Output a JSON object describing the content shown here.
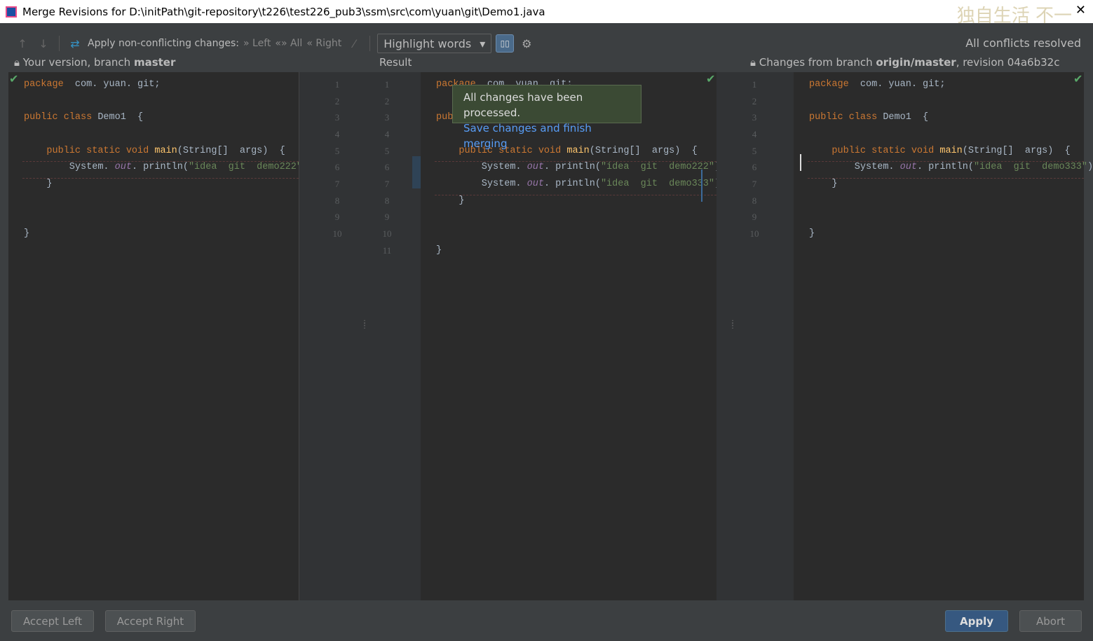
{
  "window": {
    "title": "Merge Revisions for D:\\initPath\\git-repository\\t226\\test226_pub3\\ssm\\src\\com\\yuan\\git\\Demo1.java",
    "watermark": "独自生活 不一"
  },
  "toolbar": {
    "apply_label": "Apply non-conflicting changes:",
    "left": "Left",
    "all": "All",
    "right": "Right",
    "highlight": "Highlight words",
    "status": "All conflicts resolved"
  },
  "headers": {
    "left_prefix": "Your version, branch ",
    "left_branch": "master",
    "center": "Result",
    "right_prefix": "Changes from branch ",
    "right_branch": "origin/master",
    "right_suffix": ", revision 04a6b32c"
  },
  "tooltip": {
    "message": "All changes have been processed.",
    "link": "Save changes and finish merging"
  },
  "left_lines": [
    [
      [
        "kw",
        "package"
      ],
      [
        "",
        "  com. yuan. git;"
      ]
    ],
    [],
    [
      [
        "kw",
        "public class"
      ],
      [
        "",
        " Demo1  {"
      ]
    ],
    [],
    [
      [
        "",
        "    "
      ],
      [
        "kw",
        "public static void "
      ],
      [
        "fn",
        "main"
      ],
      [
        "",
        "(String[]  args)  {"
      ]
    ],
    [
      [
        "",
        "        System. "
      ],
      [
        "it",
        "out"
      ],
      [
        "",
        ". println("
      ],
      [
        "st",
        "\"idea  git  demo222\""
      ],
      [
        "",
        ");"
      ]
    ],
    [
      [
        "",
        "    }"
      ]
    ],
    [],
    [],
    [
      [
        "",
        "}"
      ]
    ]
  ],
  "center_lines": [
    [
      [
        "kw",
        "package"
      ],
      [
        "",
        "  com. yuan. git;"
      ]
    ],
    [],
    [
      [
        "kw",
        "publ"
      ]
    ],
    [],
    [
      [
        "",
        "    "
      ],
      [
        "kw",
        "public static void "
      ],
      [
        "fn",
        "main"
      ],
      [
        "",
        "(String[]  args)  {"
      ]
    ],
    [
      [
        "",
        "        System. "
      ],
      [
        "it",
        "out"
      ],
      [
        "",
        ". println("
      ],
      [
        "st",
        "\"idea  git  demo222\""
      ],
      [
        "",
        ");"
      ]
    ],
    [
      [
        "",
        "        System. "
      ],
      [
        "it",
        "out"
      ],
      [
        "",
        ". println("
      ],
      [
        "st",
        "\"idea  git  demo333\""
      ],
      [
        "",
        ");"
      ]
    ],
    [
      [
        "",
        "    }"
      ]
    ],
    [],
    [],
    [
      [
        "",
        "}"
      ]
    ]
  ],
  "right_lines": [
    [
      [
        "kw",
        "package"
      ],
      [
        "",
        "  com. yuan. git;"
      ]
    ],
    [],
    [
      [
        "kw",
        "public class"
      ],
      [
        "",
        " Demo1  {"
      ]
    ],
    [],
    [
      [
        "",
        "    "
      ],
      [
        "kw",
        "public static void "
      ],
      [
        "fn",
        "main"
      ],
      [
        "",
        "(String[]  args)  {"
      ]
    ],
    [
      [
        "",
        "        System. "
      ],
      [
        "it",
        "out"
      ],
      [
        "",
        ". println("
      ],
      [
        "st",
        "\"idea  git  demo333\""
      ],
      [
        "",
        ");"
      ]
    ],
    [
      [
        "",
        "    }"
      ]
    ],
    [],
    [],
    [
      [
        "",
        "}"
      ]
    ]
  ],
  "gutter_left": [
    "1",
    "2",
    "3",
    "4",
    "5",
    "6",
    "7",
    "8",
    "9",
    "10"
  ],
  "gutter_center": [
    "1",
    "2",
    "3",
    "4",
    "5",
    "6",
    "7",
    "8",
    "9",
    "10",
    "11"
  ],
  "gutter_right": [
    "1",
    "2",
    "3",
    "4",
    "5",
    "6",
    "7",
    "8",
    "9",
    "10"
  ],
  "buttons": {
    "accept_left": "Accept Left",
    "accept_right": "Accept Right",
    "apply": "Apply",
    "abort": "Abort"
  }
}
